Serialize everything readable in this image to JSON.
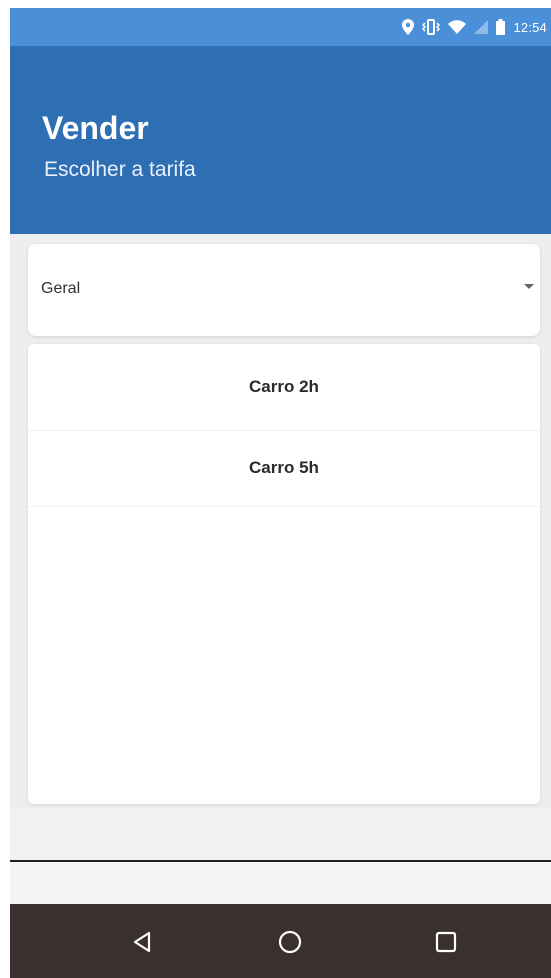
{
  "status_bar": {
    "time": "12:54",
    "icons": [
      "location-icon",
      "vibrate-icon",
      "wifi-icon",
      "signal-icon",
      "battery-icon"
    ],
    "background": "#4a8fd8"
  },
  "app_bar": {
    "title": "Vender",
    "subtitle": "Escolher a tarifa",
    "background": "#2e6fb4"
  },
  "tariff_select": {
    "selected_value": "Geral"
  },
  "tariff_list": {
    "items": [
      {
        "label": "Carro 2h"
      },
      {
        "label": "Carro 5h"
      }
    ]
  },
  "nav_bar": {
    "background": "#3a302d",
    "buttons": [
      "back-icon",
      "home-icon",
      "recents-icon"
    ]
  }
}
